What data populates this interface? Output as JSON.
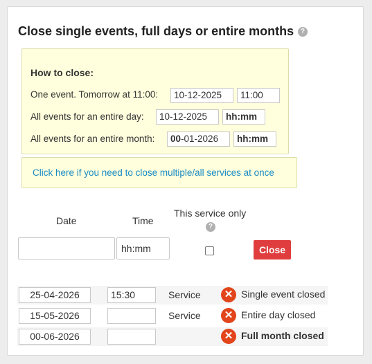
{
  "title": "Close single events, full days or entire months",
  "howto": {
    "heading": "How to close:",
    "rows": [
      {
        "label": "One event. Tomorrow at 11:00:",
        "date": "10-12-2025",
        "time": "11:00"
      },
      {
        "label": "All events for an entire day:",
        "date": "10-12-2025",
        "time": "hh:mm"
      },
      {
        "label": "All events for an entire month:",
        "date_bold": "00",
        "date_rest": "-01-2026",
        "time": "hh:mm"
      }
    ]
  },
  "link_text": "Click here if you need to close multiple/all services at once",
  "form": {
    "date_header": "Date",
    "time_header": "Time",
    "service_only_header": "This service only",
    "date_value": "",
    "time_placeholder": "hh:mm",
    "close_label": "Close"
  },
  "entries": [
    {
      "date": "25-04-2026",
      "time": "15:30",
      "service": "Service",
      "status": "Single event closed"
    },
    {
      "date": "15-05-2026",
      "time": "",
      "service": "Service",
      "status": "Entire day closed"
    },
    {
      "date": "00-06-2026",
      "time": "",
      "service": "",
      "status": "Full month closed"
    }
  ]
}
